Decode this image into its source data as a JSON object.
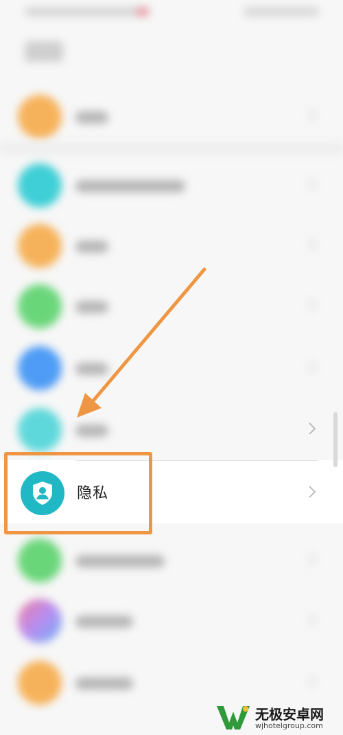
{
  "colors": {
    "accent_orange": "#ef9644",
    "privacy_icon_teal": "#1fb8c4"
  },
  "focus_item": {
    "label": "隐私",
    "icon": "shield-user-icon"
  },
  "blurred_items": [
    {
      "icon_color": "#f6b25a"
    },
    {
      "icon_color": "#3fcfd6"
    },
    {
      "icon_color": "#f6b25a"
    },
    {
      "icon_color": "#6ad67a"
    },
    {
      "icon_color": "#4e9cf5"
    },
    {
      "icon_color": "#5fd8db"
    },
    {
      "icon_color": "#6ad67a"
    },
    {
      "icon_color": "#b88cf0"
    },
    {
      "icon_color": "#f6b25a"
    }
  ],
  "watermark": {
    "title": "无极安卓网",
    "url": "wjhotelgroup.com"
  }
}
